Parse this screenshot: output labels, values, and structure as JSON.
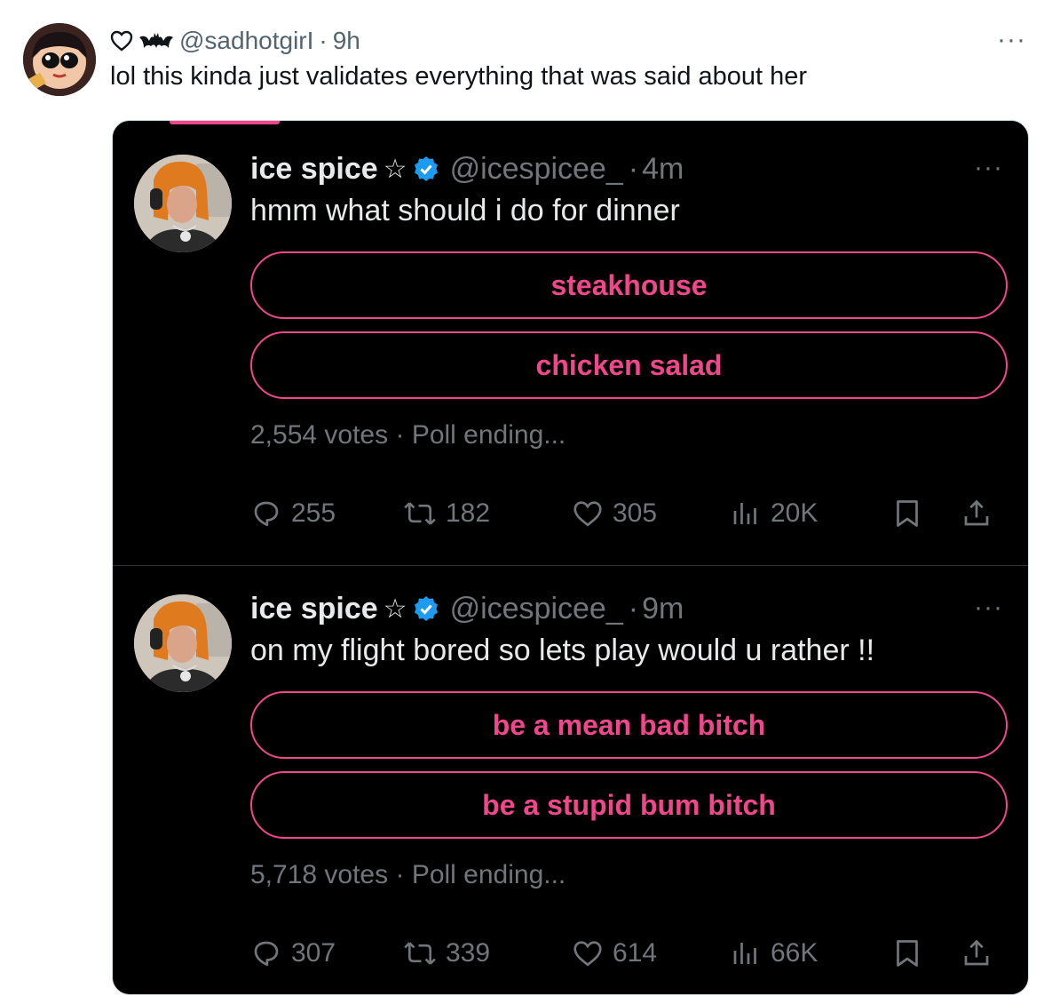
{
  "outer": {
    "handle": "@sadhotgirI",
    "sep": "·",
    "time": "9h",
    "more": "···",
    "text": "lol this kinda just validates everything that was said about her",
    "icons": [
      "heart-outline-icon",
      "bat-icon",
      "more-icon"
    ]
  },
  "screenshot": {
    "accent": "#f0468c",
    "tweets": [
      {
        "name": "ice spice",
        "star": "☆",
        "handle": "@icespicee_",
        "sep": "·",
        "time": "4m",
        "more": "···",
        "text": "hmm what should i do for dinner",
        "options": [
          "steakhouse",
          "chicken salad"
        ],
        "votes": "2,554 votes",
        "poll_status": "Poll ending...",
        "replies": "255",
        "retweets": "182",
        "likes": "305",
        "views": "20K"
      },
      {
        "name": "ice spice",
        "star": "☆",
        "handle": "@icespicee_",
        "sep": "·",
        "time": "9m",
        "more": "···",
        "text": "on my flight bored so lets play would u rather !!",
        "options": [
          "be a mean bad bitch",
          "be a stupid bum bitch"
        ],
        "votes": "5,718 votes",
        "poll_status": "Poll ending...",
        "replies": "307",
        "retweets": "339",
        "likes": "614",
        "views": "66K"
      }
    ]
  }
}
